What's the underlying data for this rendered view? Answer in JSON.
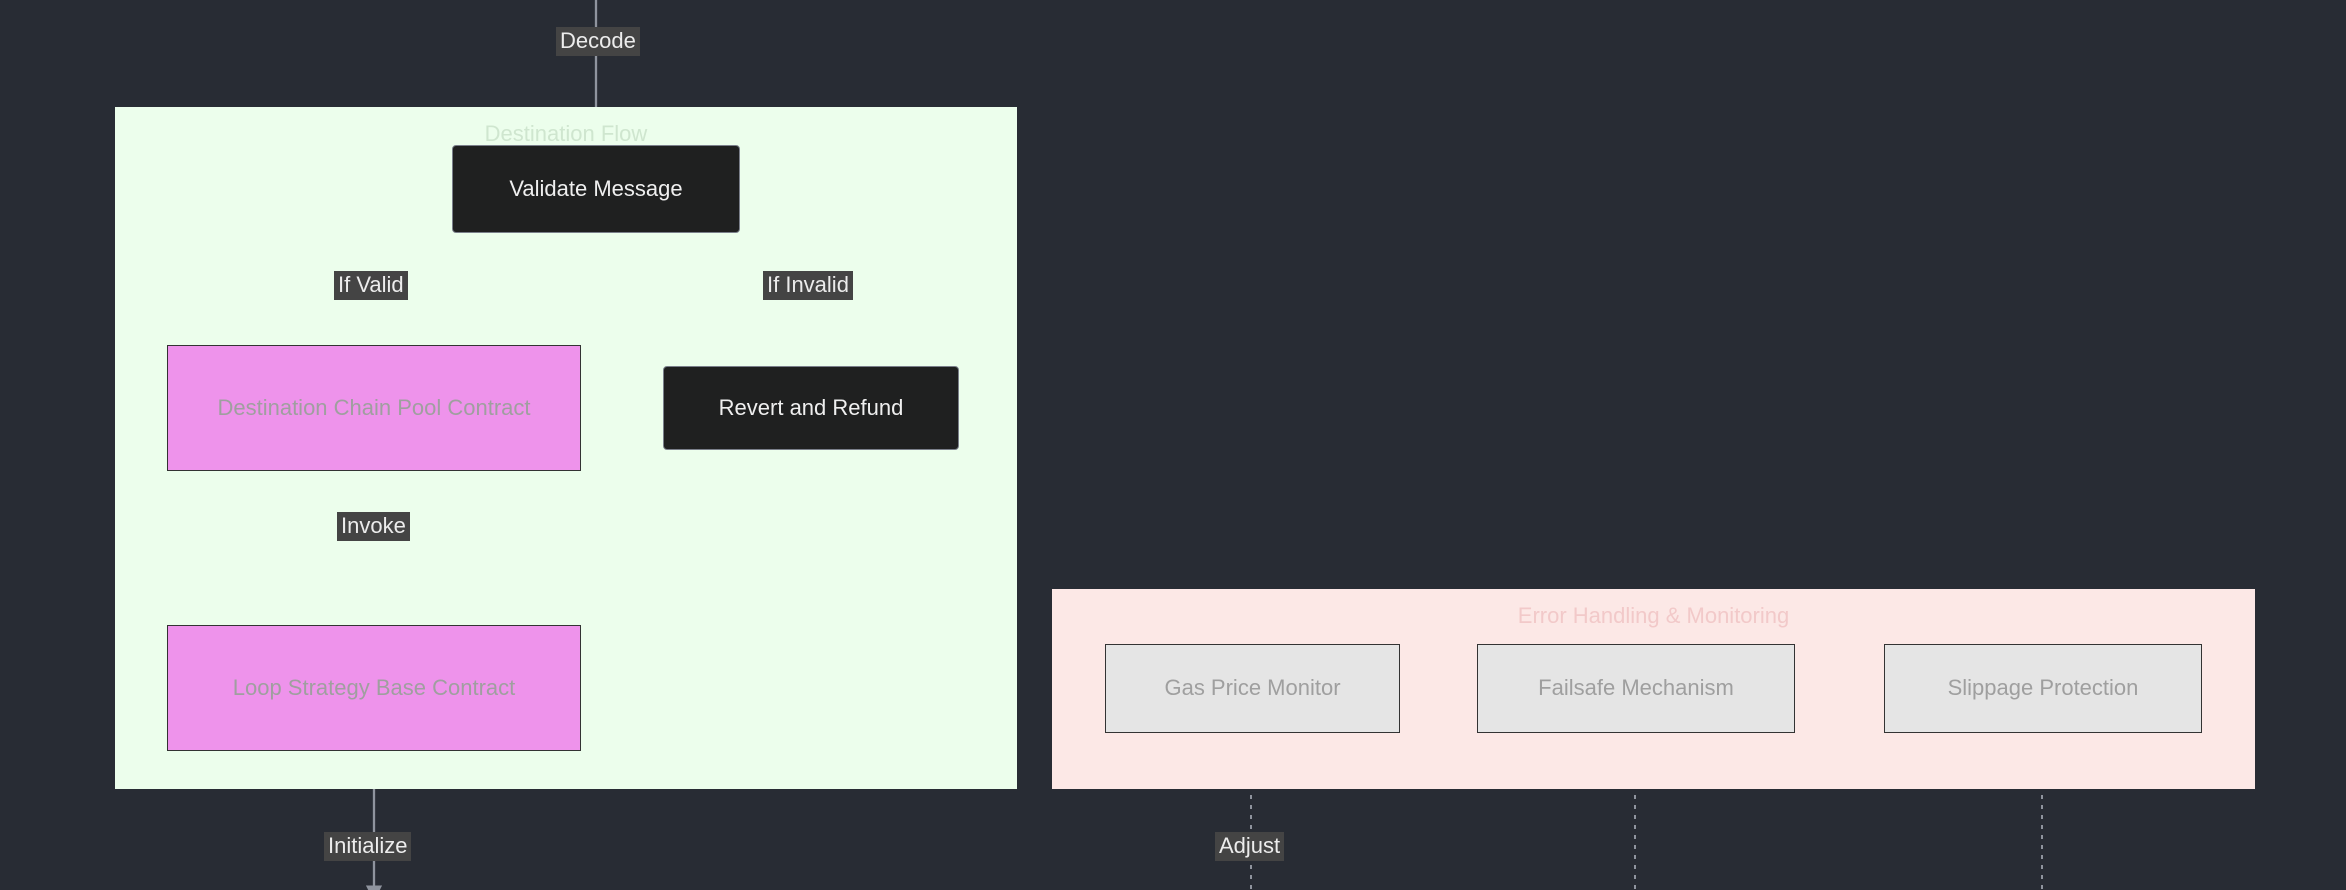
{
  "subgraphs": {
    "destinationFlow": {
      "title": "Destination Flow",
      "titleColor": "#cfe6cf",
      "bg": "#ecfeec",
      "border": "#7a7f8a"
    },
    "errorHandling": {
      "title": "Error Handling & Monitoring",
      "titleColor": "#f2c9c9",
      "bg": "#fce8e6",
      "border": "#7a7f8a"
    }
  },
  "nodes": {
    "validate": {
      "label": "Validate Message"
    },
    "revert": {
      "label": "Revert and Refund"
    },
    "destPool": {
      "label": "Destination Chain Pool Contract"
    },
    "loopBase": {
      "label": "Loop Strategy Base Contract"
    },
    "gasMonitor": {
      "label": "Gas Price Monitor"
    },
    "failsafe": {
      "label": "Failsafe Mechanism"
    },
    "slippage": {
      "label": "Slippage Protection"
    }
  },
  "edgeLabels": {
    "decode": "Decode",
    "ifValid": "If Valid",
    "ifInvalid": "If Invalid",
    "invoke": "Invoke",
    "initialize": "Initialize",
    "adjust": "Adjust"
  }
}
